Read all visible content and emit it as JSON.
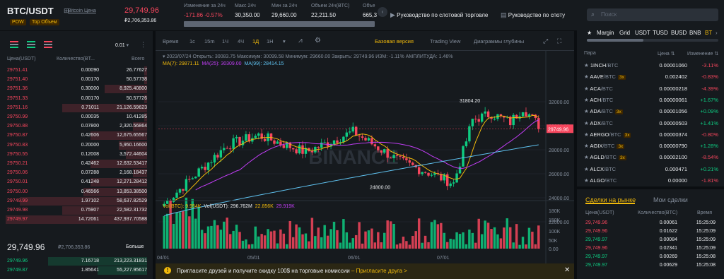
{
  "header": {
    "symbol": "BTC/USDT",
    "symbol_link": "Bitcoin Цена",
    "tags": [
      "POW",
      "Top Объем"
    ],
    "price": "29,749.96",
    "fiat_price": "₽2,706,353.86",
    "stats": [
      {
        "label": "Изменение за 24ч",
        "value": "-171.86 -0.57%"
      },
      {
        "label": "Макс 24ч",
        "value": "30,350.00"
      },
      {
        "label": "Мин за 24ч",
        "value": "29,660.00"
      },
      {
        "label": "Объем 24ч(BTC)",
        "value": "22,211.50"
      },
      {
        "label": "Объе",
        "value": "665,3"
      }
    ],
    "links": [
      "Руководство по слотовой торговле",
      "Руководство по споту"
    ]
  },
  "orderbook": {
    "precision": "0.01",
    "col_price": "Цена(USDT)",
    "col_qty": "Количество(BT...",
    "col_total": "Всего",
    "asks": [
      {
        "p": "29751.41",
        "q": "0.00090",
        "t": "26.77627",
        "d": 0.02
      },
      {
        "p": "29751.40",
        "q": "0.00170",
        "t": "50.57738",
        "d": 0.02
      },
      {
        "p": "29751.36",
        "q": "0.30000",
        "t": "8,925.40800",
        "d": 0.3
      },
      {
        "p": "29751.33",
        "q": "0.00170",
        "t": "50.57726",
        "d": 0.02
      },
      {
        "p": "29751.16",
        "q": "0.71011",
        "t": "21,126.59623",
        "d": 0.6
      },
      {
        "p": "29750.99",
        "q": "0.00035",
        "t": "10.41285",
        "d": 0.02
      },
      {
        "p": "29750.88",
        "q": "0.07800",
        "t": "2,320.56864",
        "d": 0.1
      },
      {
        "p": "29750.87",
        "q": "0.42606",
        "t": "12,675.65567",
        "d": 0.4
      },
      {
        "p": "29750.83",
        "q": "0.20000",
        "t": "5,950.16600",
        "d": 0.2
      },
      {
        "p": "29750.55",
        "q": "0.12008",
        "t": "3,572.44604",
        "d": 0.15
      },
      {
        "p": "29750.21",
        "q": "0.42462",
        "t": "12,632.53417",
        "d": 0.4
      },
      {
        "p": "29750.06",
        "q": "0.07288",
        "t": "2,168.18437",
        "d": 0.1
      },
      {
        "p": "29750.01",
        "q": "0.41248",
        "t": "12,271.28412",
        "d": 0.4
      },
      {
        "p": "29750.00",
        "q": "0.46566",
        "t": "13,853.38500",
        "d": 0.45
      },
      {
        "p": "29749.99",
        "q": "1.97102",
        "t": "58,637.82529",
        "d": 0.9
      },
      {
        "p": "29749.98",
        "q": "0.75907",
        "t": "22,582.31732",
        "d": 0.6
      },
      {
        "p": "29749.97",
        "q": "14.72061",
        "t": "437,937.70588",
        "d": 1.0
      }
    ],
    "mid_price": "29,749.96",
    "mid_fiat": "₽2,706,353.86",
    "more": "Больше",
    "bids": [
      {
        "p": "29749.96",
        "q": "7.16718",
        "t": "213,223.31831",
        "d": 0.7
      },
      {
        "p": "29749.87",
        "q": "1.85641",
        "t": "55,227.95617",
        "d": 0.35
      }
    ]
  },
  "chart": {
    "tabs": [
      "Время",
      "1с",
      "15m",
      "1Ч",
      "4Ч",
      "1Д",
      "1Н"
    ],
    "active_tab": "1Д",
    "views": [
      "Базовая версия",
      "Trading View",
      "Диаграммы глубины"
    ],
    "ohlc_line": "2023/07/24 Открыть: 30083.75 Максимум: 30099.58 Минимум: 29660.00 Закрыть: 29749.96 ИЗМ: -1.11% АМПЛИТУДА: 1.46%",
    "ma_line": [
      "MA(7): 29871.11",
      "MA(25): 30309.00",
      "MA(99): 28414.15"
    ],
    "price_labels": [
      "32000.00",
      "30000.00",
      "28000.00",
      "26000.00",
      "24000.00",
      "22000.00"
    ],
    "current_price_tag": "29749.96",
    "high_label": "31804.20",
    "low_label": "24800.00",
    "watermark": "BINANCE",
    "vol_line": [
      "Vol(BTC): 9.954K",
      "Vol(USDT): 296.762M",
      "22.856K",
      "29.919K"
    ],
    "vol_labels": [
      "180K",
      "150K",
      "100K",
      "50K",
      "0.00"
    ],
    "date_labels": [
      "04/01",
      "05/01",
      "06/01",
      "07/01"
    ]
  },
  "banner": {
    "text": "Пригласите друзей и получите скидку 100$ на торговые комиссии",
    "link": "– Пригласите друга >"
  },
  "markets": {
    "search_placeholder": "Поиск",
    "tabs": [
      "Margin",
      "Grid",
      "USDT",
      "TUSD",
      "BUSD",
      "BNB",
      "BT"
    ],
    "col_pair": "Пара",
    "col_price": "Цена",
    "col_change": "Изменение",
    "rows": [
      {
        "base": "1INCH",
        "quote": "/BTC",
        "lev": "",
        "price": "0.00001060",
        "change": "-3.11%"
      },
      {
        "base": "AAVE",
        "quote": "/BTC",
        "lev": "3x",
        "price": "0.002402",
        "change": "-0.83%"
      },
      {
        "base": "ACA",
        "quote": "/BTC",
        "lev": "",
        "price": "0.00000218",
        "change": "-4.39%"
      },
      {
        "base": "ACH",
        "quote": "/BTC",
        "lev": "",
        "price": "0.00000061",
        "change": "+1.67%"
      },
      {
        "base": "ADA",
        "quote": "/BTC",
        "lev": "3x",
        "price": "0.00001056",
        "change": "+0.09%"
      },
      {
        "base": "ADX",
        "quote": "/BTC",
        "lev": "",
        "price": "0.00000503",
        "change": "+1.41%"
      },
      {
        "base": "AERGO",
        "quote": "/BTC",
        "lev": "3x",
        "price": "0.00000374",
        "change": "-0.80%"
      },
      {
        "base": "AGIX",
        "quote": "/BTC",
        "lev": "3x",
        "price": "0.00000790",
        "change": "+1.28%"
      },
      {
        "base": "AGLD",
        "quote": "/BTC",
        "lev": "3x",
        "price": "0.00002100",
        "change": "-8.54%"
      },
      {
        "base": "ALCX",
        "quote": "/BTC",
        "lev": "",
        "price": "0.000471",
        "change": "+0.21%"
      },
      {
        "base": "ALGO",
        "quote": "/BTC",
        "lev": "",
        "price": "0.00000",
        "change": "-1.81%"
      }
    ]
  },
  "trades": {
    "tab_market": "Сделки на рынке",
    "tab_mine": "Мои сделки",
    "col_price": "Цена(USDT)",
    "col_qty": "Количество(BTC)",
    "col_time": "Время",
    "rows": [
      {
        "p": "29,749.96",
        "a": "0.00061",
        "t": "15:25:09",
        "side": "sell"
      },
      {
        "p": "29,749.96",
        "a": "0.01622",
        "t": "15:25:09",
        "side": "sell"
      },
      {
        "p": "29,749.97",
        "a": "0.00084",
        "t": "15:25:09",
        "side": "buy"
      },
      {
        "p": "29,749.96",
        "a": "0.02341",
        "t": "15:25:09",
        "side": "sell"
      },
      {
        "p": "29,749.97",
        "a": "0.00269",
        "t": "15:25:08",
        "side": "buy"
      },
      {
        "p": "29,749.97",
        "a": "0.00629",
        "t": "15:25:08",
        "side": "buy"
      }
    ]
  },
  "colors": {
    "up": "#0ecb81",
    "down": "#f6465d",
    "accent": "#f0b90b",
    "ma7": "#f0b90b",
    "ma25": "#c13df5",
    "ma99": "#5fc2f0"
  }
}
